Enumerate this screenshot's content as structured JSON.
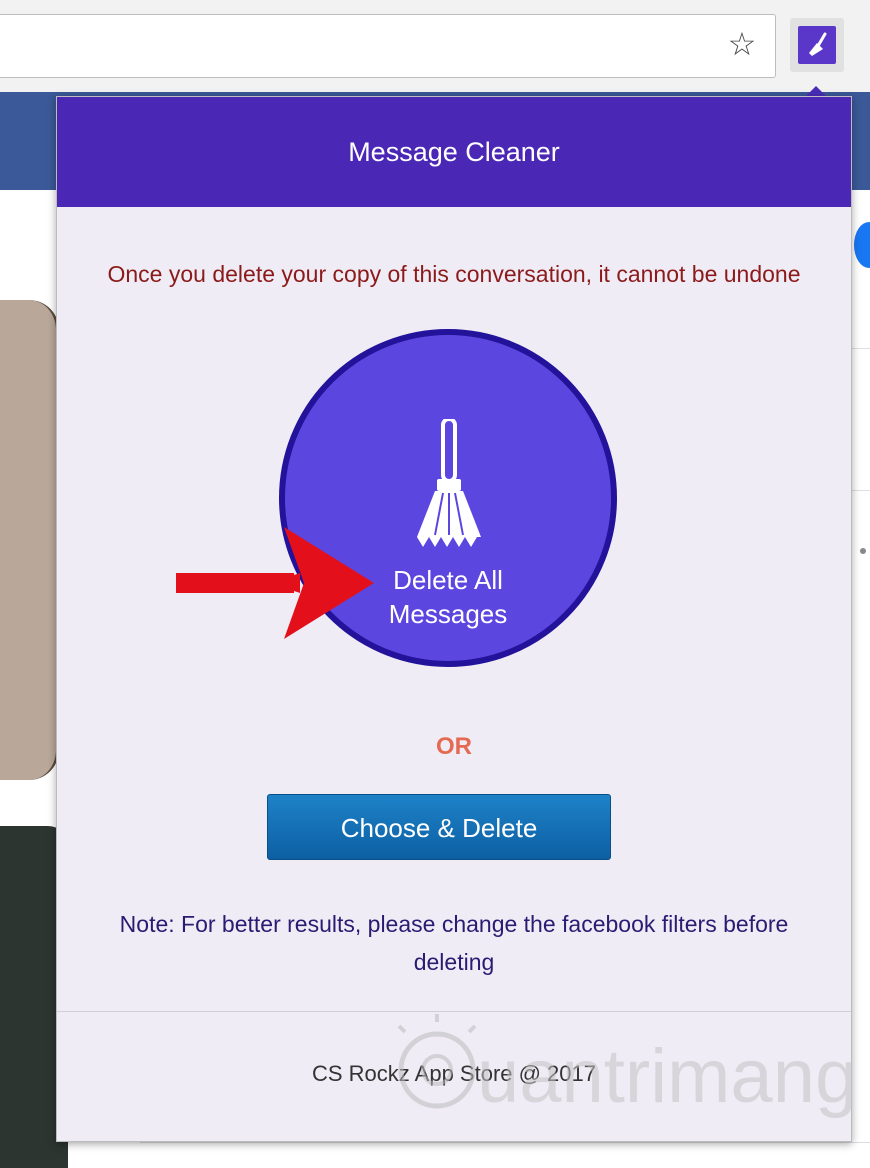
{
  "popup": {
    "title": "Message Cleaner",
    "warning": "Once you delete your copy of this conversation, it cannot be undone",
    "delete_all_line1": "Delete All",
    "delete_all_line2": "Messages",
    "or": "OR",
    "choose_delete": "Choose & Delete",
    "note": "Note: For better results, please change the facebook filters before deleting",
    "footer": "CS Rockz App Store @ 2017"
  },
  "browser": {
    "bookmark_icon": "star-icon",
    "extension_icon": "broom-icon"
  },
  "watermark": "uantrimang",
  "colors": {
    "header": "#4a28b5",
    "circle": "#5b46e0",
    "warning_text": "#8b1a1a",
    "or_text": "#e56a52",
    "button": "#1170b8"
  }
}
